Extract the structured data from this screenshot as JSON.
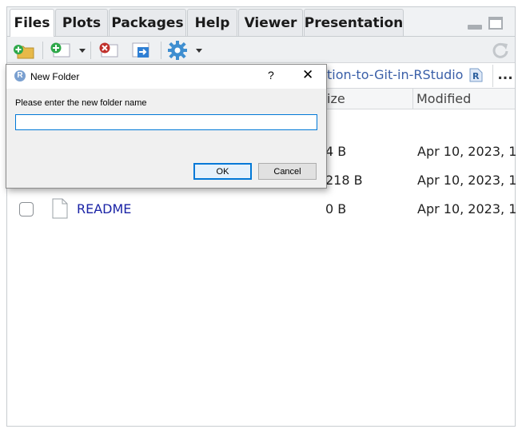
{
  "tabs": [
    {
      "label": "Files",
      "active": true
    },
    {
      "label": "Plots",
      "active": false
    },
    {
      "label": "Packages",
      "active": false
    },
    {
      "label": "Help",
      "active": false
    },
    {
      "label": "Viewer",
      "active": false
    },
    {
      "label": "Presentation",
      "active": false
    }
  ],
  "breadcrumb": {
    "text": "tion-to-Git-in-RStudio",
    "more_label": "..."
  },
  "columns": {
    "size": "ize",
    "modified": "Modified"
  },
  "files": [
    {
      "name": "",
      "size": "4 B",
      "modified": "Apr 10, 2023, 1"
    },
    {
      "name": "",
      "size": "218 B",
      "modified": "Apr 10, 2023, 1"
    },
    {
      "name": "README",
      "size": "0 B",
      "modified": "Apr 10, 2023, 1"
    }
  ],
  "dialog": {
    "title": "New Folder",
    "help": "?",
    "close": "✕",
    "app_icon_letter": "R",
    "prompt": "Please enter the new folder name",
    "input_value": "",
    "ok_label": "OK",
    "cancel_label": "Cancel"
  },
  "colors": {
    "accent": "#0078d7",
    "link": "#1a23a6",
    "breadcrumb": "#3a5fa8"
  }
}
